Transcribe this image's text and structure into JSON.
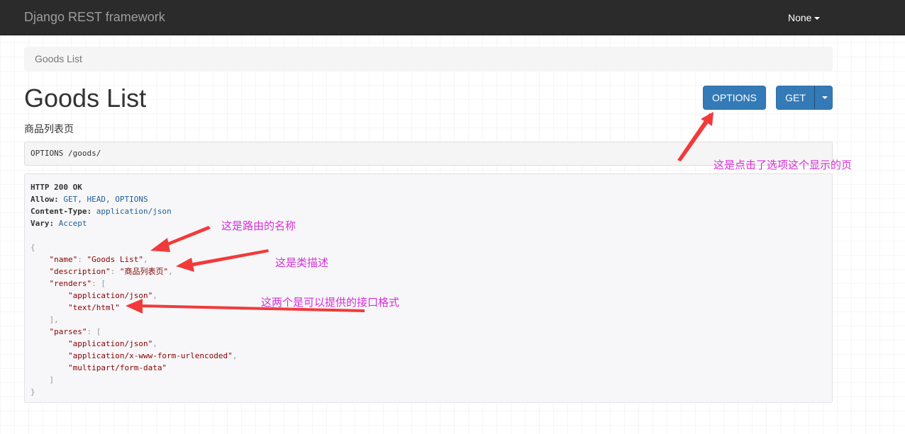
{
  "navbar": {
    "brand": "Django REST framework",
    "user_menu": "None"
  },
  "breadcrumb": {
    "item": "Goods List"
  },
  "page": {
    "title": "Goods List",
    "description": "商品列表页"
  },
  "buttons": {
    "options": "OPTIONS",
    "get": "GET"
  },
  "request": {
    "method": "OPTIONS",
    "path": "/goods/"
  },
  "response": {
    "status": "HTTP 200 OK",
    "headers": [
      {
        "key": "Allow",
        "value": "GET, HEAD, OPTIONS"
      },
      {
        "key": "Content-Type",
        "value": "application/json"
      },
      {
        "key": "Vary",
        "value": "Accept"
      }
    ],
    "body": {
      "name_key": "\"name\"",
      "name_value": "\"Goods List\"",
      "description_key": "\"description\"",
      "description_value": "\"商品列表页\"",
      "renders_key": "\"renders\"",
      "renders": [
        "\"application/json\"",
        "\"text/html\""
      ],
      "parses_key": "\"parses\"",
      "parses": [
        "\"application/json\"",
        "\"application/x-www-form-urlencoded\"",
        "\"multipart/form-data\""
      ]
    }
  },
  "annotations": {
    "options_page": "这是点击了选项这个显示的页",
    "route_name": "这是路由的名称",
    "class_description": "这是类描述",
    "formats": "这两个是可以提供的接口格式"
  },
  "colors": {
    "annotation": "#d62fd6",
    "arrow": "#f23a3a",
    "button": "#337ab7",
    "navbar": "#2b2b2b"
  }
}
